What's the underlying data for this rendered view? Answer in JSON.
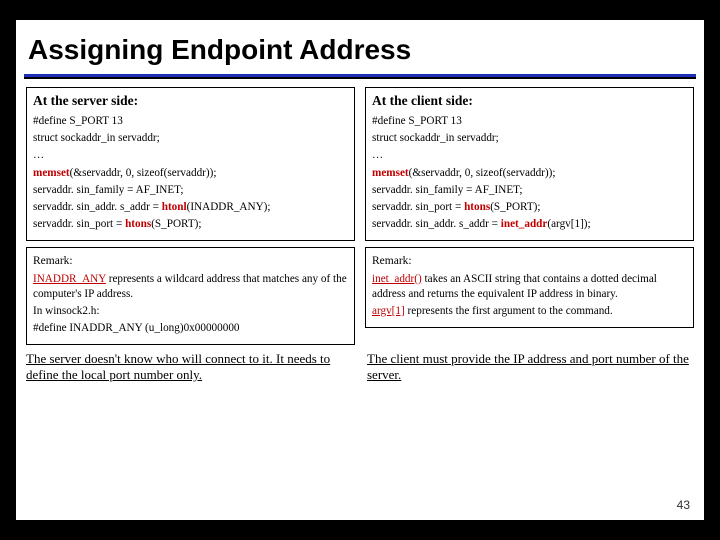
{
  "title": "Assigning Endpoint Address",
  "page_number": "43",
  "server": {
    "heading": "At the server side:",
    "l1": "#define S_PORT 13",
    "l2": "struct sockaddr_in servaddr;",
    "l3": "…",
    "l4a": "memset",
    "l4b": "(&servaddr, 0, sizeof(servaddr));",
    "l5": "servaddr. sin_family = AF_INET;",
    "l6a": "servaddr. sin_addr. s_addr = ",
    "l6b": "htonl",
    "l6c": "(INADDR_ANY);",
    "l7a": "servaddr. sin_port = ",
    "l7b": "htons",
    "l7c": "(S_PORT);",
    "rem_heading": "Remark:",
    "rem_1a": "INADDR_ANY",
    "rem_1b": " represents a wildcard address that matches any of the computer's IP address.",
    "rem_2": "In winsock2.h:",
    "rem_3": "#define INADDR_ANY (u_long)0x00000000",
    "footer": "The server doesn't know who will connect to it. It needs to define the local port number only."
  },
  "client": {
    "heading": "At the client side:",
    "l1": "#define S_PORT 13",
    "l2": "struct sockaddr_in servaddr;",
    "l3": "…",
    "l4a": "memset",
    "l4b": "(&servaddr, 0, sizeof(servaddr));",
    "l5": "servaddr. sin_family = AF_INET;",
    "l6a": "servaddr. sin_port = ",
    "l6b": "htons",
    "l6c": "(S_PORT);",
    "l7a": "servaddr. sin_addr. s_addr = ",
    "l7b": "inet_addr",
    "l7c": "(argv[1]);",
    "rem_heading": "Remark:",
    "rem_1a": "inet_addr()",
    "rem_1b": " takes an ASCII string that contains a dotted decimal address and returns the equivalent IP address in binary.",
    "rem_2a": "argv[1]",
    "rem_2b": " represents the first argument to the command.",
    "footer": "The client must provide the IP address and port number of the server."
  }
}
